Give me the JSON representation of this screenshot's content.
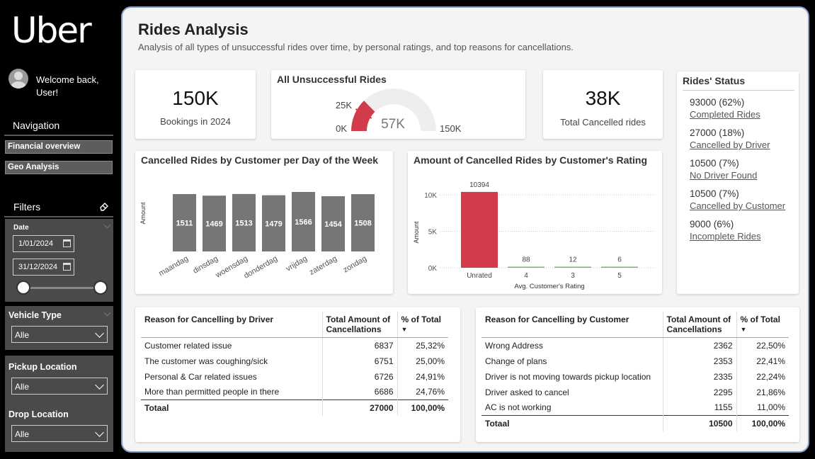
{
  "sidebar": {
    "logo": "Uber",
    "welcome": "Welcome back, User!",
    "nav_title": "Navigation",
    "nav_items": [
      "Financial overview",
      "Geo Analysis"
    ],
    "filters_title": "Filters",
    "date_label": "Date",
    "date_start": "1/01/2024",
    "date_end": "31/12/2024",
    "vehicle_label": "Vehicle Type",
    "vehicle_value": "Alle",
    "pickup_label": "Pickup Location",
    "pickup_value": "Alle",
    "drop_label": "Drop Location",
    "drop_value": "Alle"
  },
  "header": {
    "title": "Rides Analysis",
    "subtitle": "Analysis of all types of unsuccessful rides over time, by personal ratings, and top reasons for cancellations."
  },
  "kpis": {
    "bookings_value": "150K",
    "bookings_label": "Bookings in 2024",
    "cancelled_value": "38K",
    "cancelled_label": "Total Cancelled rides"
  },
  "gauge": {
    "title": "All Unsuccessful Rides",
    "value": 38000,
    "target": 25000,
    "min": 0,
    "max": 150000,
    "value_label": "57K",
    "target_label": "25K",
    "min_label": "0K",
    "max_label": "150K"
  },
  "status": {
    "title": "Rides' Status",
    "items": [
      {
        "value": "93000 (62%)",
        "label": "Completed Rides"
      },
      {
        "value": "27000 (18%)",
        "label": "Cancelled by Driver"
      },
      {
        "value": "10500 (7%)",
        "label": "No Driver Found"
      },
      {
        "value": "10500 (7%)",
        "label": "Cancelled by Customer"
      },
      {
        "value": "9000 (6%)",
        "label": "Incomplete Rides"
      }
    ]
  },
  "chart_data": [
    {
      "type": "bar",
      "title": "Cancelled Rides by Customer per Day of the Week",
      "ylabel": "Amount",
      "xlabel": "",
      "categories": [
        "maandag",
        "dinsdag",
        "woensdag",
        "donderdag",
        "vrijdag",
        "zaterdag",
        "zondag"
      ],
      "values": [
        1511,
        1469,
        1513,
        1479,
        1566,
        1454,
        1508
      ],
      "color": "#767676"
    },
    {
      "type": "bar",
      "title": "Amount of Cancelled Rides by Customer's Rating",
      "ylabel": "Amount",
      "xlabel": "Avg. Customer's Rating",
      "categories": [
        "Unrated",
        "4",
        "3",
        "5"
      ],
      "values": [
        10394,
        88,
        12,
        6
      ],
      "ylim": [
        0,
        10000
      ],
      "yticks": [
        "0K",
        "5K",
        "10K"
      ],
      "colors": [
        "#d13b4a",
        "#6cb86c",
        "#6cb86c",
        "#6cb86c"
      ]
    }
  ],
  "driver_table": {
    "headers": [
      "Reason for Cancelling by Driver",
      "Total Amount of Cancellations",
      "% of Total"
    ],
    "rows": [
      [
        "Customer related issue",
        "6837",
        "25,32%"
      ],
      [
        "The customer was coughing/sick",
        "6751",
        "25,00%"
      ],
      [
        "Personal & Car related issues",
        "6726",
        "24,91%"
      ],
      [
        "More than permitted people in there",
        "6686",
        "24,76%"
      ]
    ],
    "total": [
      "Totaal",
      "27000",
      "100,00%"
    ]
  },
  "customer_table": {
    "headers": [
      "Reason for Cancelling by Customer",
      "Total Amount of Cancellations",
      "% of Total"
    ],
    "rows": [
      [
        "Wrong Address",
        "2362",
        "22,50%"
      ],
      [
        "Change of plans",
        "2353",
        "22,41%"
      ],
      [
        "Driver is not moving towards pickup location",
        "2335",
        "22,24%"
      ],
      [
        "Driver asked to cancel",
        "2295",
        "21,86%"
      ],
      [
        "AC is not working",
        "1155",
        "11,00%"
      ]
    ],
    "total": [
      "Totaal",
      "10500",
      "100,00%"
    ]
  },
  "colors": {
    "accent_red": "#d13b4a",
    "bar_gray": "#767676",
    "bar_green": "#6cb86c",
    "sidebar_bg": "#000000",
    "main_bg": "#f4f4f4"
  }
}
